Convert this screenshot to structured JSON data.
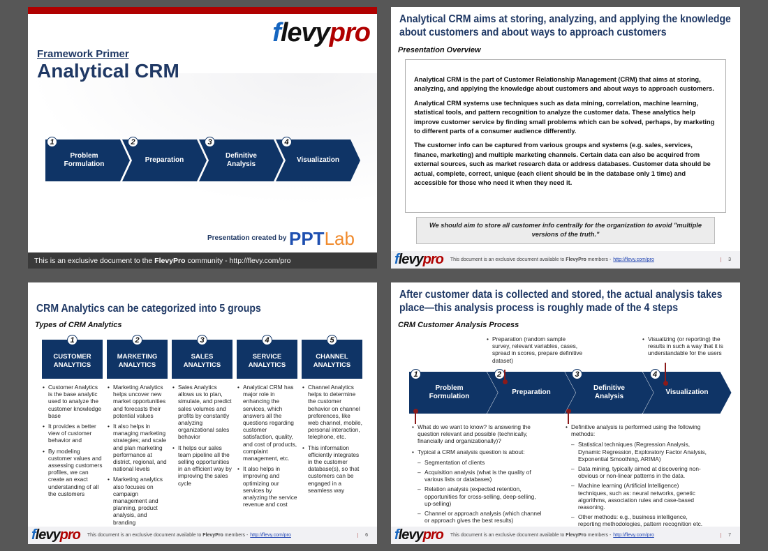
{
  "slide1": {
    "logo": {
      "f": "f",
      "l": "levy",
      "p": "pro"
    },
    "kicker": "Framework Primer",
    "title": "Analytical CRM",
    "steps": [
      {
        "n": "1",
        "label": "Problem Formulation"
      },
      {
        "n": "2",
        "label": "Preparation"
      },
      {
        "n": "3",
        "label": "Definitive Analysis"
      },
      {
        "n": "4",
        "label": "Visualization"
      }
    ],
    "created_by": "Presentation created by",
    "pptlab": {
      "a": "PPT",
      "b": "Lab"
    },
    "footer_pre": "This is an exclusive document to the ",
    "footer_brand": "FlevyPro",
    "footer_post": " community - http://flevy.com/pro",
    "accent": "#b00000"
  },
  "slide2": {
    "title": "Analytical CRM aims at storing, analyzing, and applying the knowledge about customers and about ways to approach customers",
    "subtitle": "Presentation Overview",
    "paragraphs": [
      "Analytical CRM is the part of Customer Relationship Management (CRM) that aims at storing, analyzing, and applying the knowledge about customers and about ways to approach customers.",
      "Analytical CRM systems use techniques such as data mining, correlation, machine learning, statistical tools, and pattern recognition to analyze the customer data. These analytics help improve customer service by finding small problems which can be solved, perhaps, by marketing to different parts of a consumer audience differently.",
      "The customer info can be captured from various groups and systems (e.g. sales, services, finance, marketing) and multiple marketing channels.  Certain data can also be acquired from external sources, such as market research data or address databases.  Customer data should be actual, complete, correct, unique (each client should be in the database only 1 time) and accessible for those who need it when they need it."
    ],
    "quote": "We should aim to store all customer info centrally for the organization to avoid \"multiple versions of the truth.\"",
    "page": "3"
  },
  "footer": {
    "pre": "This document is an exclusive document available to ",
    "brand": "FlevyPro",
    "post": " members - ",
    "link": "http://flevy.com/pro"
  },
  "slide3": {
    "title": "CRM Analytics can be categorized into 5 groups",
    "subtitle": "Types of CRM Analytics",
    "groups": [
      {
        "n": "1",
        "label": "CUSTOMER ANALYTICS",
        "bullets": [
          "Customer Analytics is the base analytic used to analyze the customer knowledge base",
          "It provides a better view of customer behavior and",
          "By modeling customer values and assessing customers profiles, we can create an exact understanding of all the customers"
        ]
      },
      {
        "n": "2",
        "label": "MARKETING ANALYTICS",
        "bullets": [
          "Marketing Analytics helps uncover new market opportunities and forecasts their potential values",
          "It also helps in managing marketing strategies; and scale and plan marketing performance at district, regional, and national levels",
          "Marketing analytics also focuses on campaign management and planning, product analysis, and branding"
        ]
      },
      {
        "n": "3",
        "label": "SALES ANALYTICS",
        "bullets": [
          "Sales Analytics allows us to plan, simulate, and predict sales volumes and profits by constantly analyzing organizational sales behavior",
          "It helps our sales team pipeline all the selling opportunities in an efficient way by improving the sales cycle"
        ]
      },
      {
        "n": "4",
        "label": "SERVICE ANALYTICS",
        "bullets": [
          "Analytical CRM has major role in enhancing the services, which answers all the questions regarding customer satisfaction, quality, and cost of products, complaint management, etc.",
          "It also helps in improving and optimizing our services by analyzing the service revenue and cost"
        ]
      },
      {
        "n": "5",
        "label": "CHANNEL ANALYTICS",
        "bullets": [
          "Channel Analytics helps to determine the customer behavior on channel preferences, like web channel, mobile, personal interaction, telephone, etc.",
          "This information efficiently integrates in the customer database(s), so that customers can be engaged in a seamless way"
        ]
      }
    ],
    "page": "6"
  },
  "slide4": {
    "title": "After customer data is collected and stored, the actual analysis takes place—this analysis process is roughly made of the 4 steps",
    "subtitle": "CRM Customer Analysis Process",
    "steps": [
      {
        "n": "1",
        "label": "Problem Formulation"
      },
      {
        "n": "2",
        "label": "Preparation"
      },
      {
        "n": "3",
        "label": "Definitive Analysis"
      },
      {
        "n": "4",
        "label": "Visualization"
      }
    ],
    "callout_prep": "Preparation (random sample survey, relevant variables, cases, spread in scores, prepare definitive dataset)",
    "callout_vis": "Visualizing (or reporting) the results in such a way that it is understandable for the users",
    "left": [
      {
        "t": "What do we want to know? Is answering the question relevant and possible (technically, financially and organizationally)?",
        "d": 0
      },
      {
        "t": "Typical a CRM analysis question is about:",
        "d": 0
      },
      {
        "t": "Segmentation of clients",
        "d": 1
      },
      {
        "t": "Acquisition analysis (what is the quality of various lists or databases)",
        "d": 1
      },
      {
        "t": "Relation analysis (expected retention, opportunities for cross-selling, deep-selling, up-selling)",
        "d": 1
      },
      {
        "t": "Channel or approach analysis (which channel or approach gives the best results)",
        "d": 1
      }
    ],
    "right": [
      {
        "t": "Definitive analysis is performed using the following methods:",
        "d": 0
      },
      {
        "t": "Statistical techniques (Regression Analysis, Dynamic Regression, Exploratory Factor Analysis, Exponential Smoothing, ARIMA)",
        "d": 1
      },
      {
        "t": "Data mining, typically aimed at discovering non-obvious or non-linear patterns in the data.",
        "d": 1
      },
      {
        "t": "Machine learning (Artificial Intelligence) techniques, such as: neural networks, genetic algorithms, association rules and case-based reasoning.",
        "d": 1
      },
      {
        "t": "Other methods: e.g., business intelligence, reporting methodologies, pattern recognition etc.",
        "d": 1
      }
    ],
    "page": "7"
  },
  "colors": {
    "navy": "#0f3466",
    "title_blue": "#1f3864",
    "red": "#b00000",
    "pin": "#8b1a1a"
  }
}
